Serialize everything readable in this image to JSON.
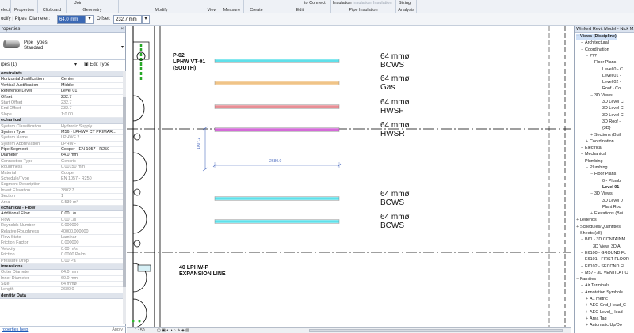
{
  "ribbon": {
    "buttons": [
      {
        "label": "elect",
        "dim": false
      },
      {
        "label": "Properties",
        "dim": false
      },
      {
        "label": "Clipboard",
        "dim": false
      },
      {
        "label": "Join",
        "dim": false
      },
      {
        "label": "Geometry",
        "dim": false
      },
      {
        "label": "Modify",
        "dim": false
      },
      {
        "label": "View",
        "dim": false
      },
      {
        "label": "Measure",
        "dim": false
      },
      {
        "label": "Create",
        "dim": false
      },
      {
        "label": "to Connect",
        "dim": false
      },
      {
        "label": "Edit",
        "dim": false
      },
      {
        "label": "Insulation",
        "dim": false
      },
      {
        "label": "Insulation",
        "dim": true
      },
      {
        "label": "Insulation",
        "dim": true
      },
      {
        "label": "Pipe Insulation",
        "dim": false
      },
      {
        "label": "Sizing",
        "dim": false
      },
      {
        "label": "Analysis",
        "dim": false
      }
    ]
  },
  "optbar": {
    "context": "odify | Pipes",
    "diameter_label": "Diameter:",
    "diameter_value": "64.0 mm",
    "offset_label": "Offset:",
    "offset_value": "232.7 mm"
  },
  "properties": {
    "title": "roperties",
    "close": "×",
    "type_name": "Pipe Types",
    "type_sub": "Standard",
    "instance": "ipes (1)",
    "edit_type": "Edit Type",
    "rows": [
      {
        "sec": "onstraints"
      },
      {
        "k": "Horizontal Justification",
        "v": "Center"
      },
      {
        "k": "Vertical Justification",
        "v": "Middle"
      },
      {
        "k": "Reference Level",
        "v": "Level 01"
      },
      {
        "k": "Offset",
        "v": "232.7"
      },
      {
        "k": "Start Offset",
        "v": "232.7",
        "grey": true
      },
      {
        "k": "End Offset",
        "v": "232.7",
        "grey": true
      },
      {
        "k": "Slope",
        "v": "1:0.00",
        "grey": true
      },
      {
        "sec": "echanical"
      },
      {
        "k": "System Classification",
        "v": "Hydronic Supply",
        "grey": true
      },
      {
        "k": "System Type",
        "v": "M56 - LPHWF CT PRIMAR..."
      },
      {
        "k": "System Name",
        "v": "LPHWF 2",
        "grey": true
      },
      {
        "k": "System Abbreviation",
        "v": "LPHWF",
        "grey": true
      },
      {
        "k": "Pipe Segment",
        "v": "Copper - EN 1057 - R250"
      },
      {
        "k": "Diameter",
        "v": "64.0 mm"
      },
      {
        "k": "Connection Type",
        "v": "Generic",
        "grey": true
      },
      {
        "k": "Roughness",
        "v": "0.00150 mm",
        "grey": true
      },
      {
        "k": "Material",
        "v": "Copper",
        "grey": true
      },
      {
        "k": "Schedule/Type",
        "v": "EN 1057 - R250",
        "grey": true
      },
      {
        "k": "Segment Description",
        "v": "",
        "grey": true
      },
      {
        "k": "Invert Elevation",
        "v": "3802.7",
        "grey": true
      },
      {
        "k": "Section",
        "v": "1",
        "grey": true
      },
      {
        "k": "Area",
        "v": "0.539 m²",
        "grey": true
      },
      {
        "sec": "echanical - Flow"
      },
      {
        "k": "Additional Flow",
        "v": "0.00 L/s"
      },
      {
        "k": "Flow",
        "v": "0.00 L/s",
        "grey": true
      },
      {
        "k": "Reynolds Number",
        "v": "0.000000",
        "grey": true
      },
      {
        "k": "Relative Roughness",
        "v": "40000.000000",
        "grey": true
      },
      {
        "k": "Flow State",
        "v": "Laminar",
        "grey": true
      },
      {
        "k": "Friction Factor",
        "v": "0.000000",
        "grey": true
      },
      {
        "k": "Velocity",
        "v": "0.00 m/s",
        "grey": true
      },
      {
        "k": "Friction",
        "v": "0.0000 Pa/m",
        "grey": true
      },
      {
        "k": "Pressure Drop",
        "v": "0.00 Pa",
        "grey": true
      },
      {
        "sec": "imensions"
      },
      {
        "k": "Outer Diameter",
        "v": "64.0 mm",
        "grey": true
      },
      {
        "k": "Inner Diameter",
        "v": "60.0 mm",
        "grey": true
      },
      {
        "k": "Size",
        "v": "64 mmø",
        "grey": true
      },
      {
        "k": "Length",
        "v": "2680.0",
        "grey": true
      },
      {
        "sec": "dentity Data"
      }
    ],
    "help": "roperties help",
    "apply": "Apply"
  },
  "canvas": {
    "tag1": [
      "P-02",
      "LPHW VT-01",
      "(SOUTH)"
    ],
    "tag2": [
      "40",
      "LPHW-P",
      "EXPANSION LINE"
    ],
    "dim_vertical": "1007.2",
    "dim_horizontal": "2680.0",
    "pipes": [
      {
        "size": "64 mmø",
        "name": "BCWS",
        "color": "#5fe0ea"
      },
      {
        "size": "64 mmø",
        "name": "Gas",
        "color": "#f0c487"
      },
      {
        "size": "64 mmø",
        "name": "HWSF",
        "color": "#e88e95"
      },
      {
        "size": "64 mmø",
        "name": "HWSR",
        "color": "#d46ad8"
      },
      {
        "size": "64 mmø",
        "name": "BCWS",
        "color": "#5fe0ea"
      },
      {
        "size": "64 mmø",
        "name": "BCWS",
        "color": "#5fe0ea"
      }
    ]
  },
  "viewbar": {
    "scale": "1 : 50"
  },
  "browser": {
    "title": "Winford Revit Model - Nick M...",
    "items": [
      {
        "t": "Views (Discipline)",
        "tog": "−",
        "bold": true,
        "sel": true
      },
      {
        "t": "Architectural",
        "tog": "+"
      },
      {
        "t": "Coordination",
        "tog": "−"
      },
      {
        "t": "???",
        "tog": "−"
      },
      {
        "t": "Floor Plans",
        "tog": "−"
      },
      {
        "t": "Level 0 - C",
        "tog": ""
      },
      {
        "t": "Level 01 - ",
        "tog": ""
      },
      {
        "t": "Level 02 - ",
        "tog": ""
      },
      {
        "t": "Roof - Co",
        "tog": ""
      },
      {
        "t": "3D Views",
        "tog": "−"
      },
      {
        "t": "3D Level C",
        "tog": ""
      },
      {
        "t": "3D Level C",
        "tog": ""
      },
      {
        "t": "3D Level C",
        "tog": ""
      },
      {
        "t": "3D Roof - ",
        "tog": ""
      },
      {
        "t": "{3D}",
        "tog": ""
      },
      {
        "t": "Sections (Buil",
        "tog": "+"
      },
      {
        "t": "Coordination",
        "tog": "+"
      },
      {
        "t": "Electrical",
        "tog": "+"
      },
      {
        "t": "Mechanical",
        "tog": "+"
      },
      {
        "t": "Plumbing",
        "tog": "−"
      },
      {
        "t": "Plumbing",
        "tog": "−"
      },
      {
        "t": "Floor Plans",
        "tog": "−"
      },
      {
        "t": "0 - Plumb",
        "tog": ""
      },
      {
        "t": "Level 01",
        "tog": "",
        "bold": true
      },
      {
        "t": "3D Views",
        "tog": "−"
      },
      {
        "t": "3D Level 0",
        "tog": ""
      },
      {
        "t": "Plant Roo",
        "tog": ""
      },
      {
        "t": "Elevations (Bui",
        "tog": "+"
      },
      {
        "t": "Legends",
        "tog": "+"
      },
      {
        "t": "Schedules/Quantities",
        "tog": "+"
      },
      {
        "t": "Sheets (all)",
        "tog": "−"
      },
      {
        "t": "B61 - 3D CONTAINM",
        "tog": "−"
      },
      {
        "t": "3D View: 3D A",
        "tog": ""
      },
      {
        "t": "E6100 - GROUND FL",
        "tog": "+"
      },
      {
        "t": "E6101 - FIRST FLOOR",
        "tog": "+"
      },
      {
        "t": "E6102 - SECOND FL",
        "tog": "+"
      },
      {
        "t": "M57 - 3D VENTILATIO",
        "tog": "+"
      },
      {
        "t": "Families",
        "tog": "−"
      },
      {
        "t": "Air Terminals",
        "tog": "+"
      },
      {
        "t": "Annotation Symbols",
        "tog": "−"
      },
      {
        "t": "A1 metric",
        "tog": "+"
      },
      {
        "t": "AEC-Grid_Head_C",
        "tog": "+"
      },
      {
        "t": "AEC-Level_Head",
        "tog": "+"
      },
      {
        "t": "Area Tag",
        "tog": "+"
      },
      {
        "t": "Automatic Up/Do",
        "tog": "+"
      }
    ]
  }
}
